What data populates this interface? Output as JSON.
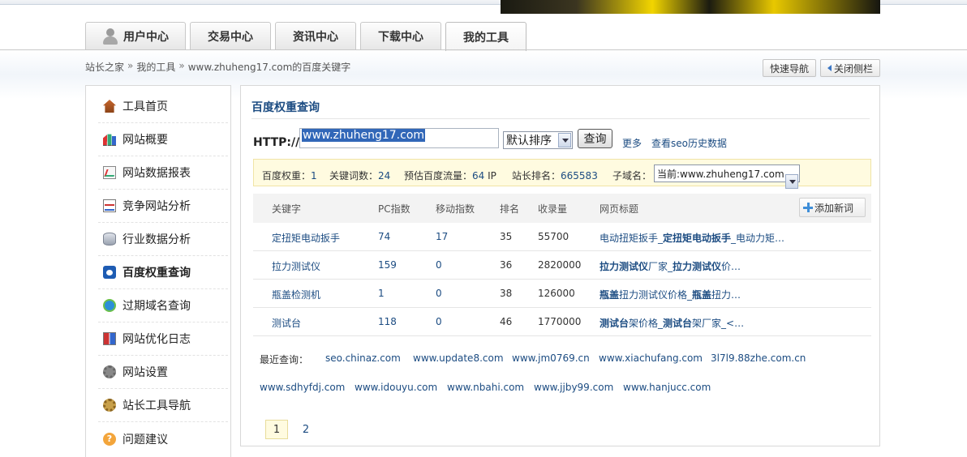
{
  "tabs": [
    {
      "label": "用户中心",
      "icon": "user-icon"
    },
    {
      "label": "交易中心"
    },
    {
      "label": "资讯中心"
    },
    {
      "label": "下载中心"
    },
    {
      "label": "我的工具",
      "active": true
    }
  ],
  "breadcrumb": {
    "home": "站长之家",
    "sep": "»",
    "section": "我的工具",
    "current": "www.zhuheng17.com的百度关键字"
  },
  "top_buttons": {
    "quick_nav": "快速导航",
    "close_side": "关闭侧栏"
  },
  "sidebar": {
    "items": [
      {
        "label": "工具首页",
        "icon": "home-icon"
      },
      {
        "label": "网站概要",
        "icon": "bar-chart-icon"
      },
      {
        "label": "网站数据报表",
        "icon": "report-icon"
      },
      {
        "label": "竞争网站分析",
        "icon": "compete-icon"
      },
      {
        "label": "行业数据分析",
        "icon": "database-icon"
      },
      {
        "label": "百度权重查询",
        "icon": "baidu-paw-icon",
        "active": true
      },
      {
        "label": "过期域名查询",
        "icon": "expire-domain-icon"
      },
      {
        "label": "网站优化日志",
        "icon": "log-book-icon"
      },
      {
        "label": "网站设置",
        "icon": "gear-icon"
      },
      {
        "label": "站长工具导航",
        "icon": "nav-compass-icon"
      },
      {
        "label": "问题建议",
        "icon": "help-icon"
      }
    ]
  },
  "main": {
    "title": "百度权重查询",
    "http_label": "HTTP://",
    "url_value": "www.zhuheng17.com",
    "sort_value": "默认排序",
    "query_label": "查询",
    "more_link": "更多",
    "history_link": "查看seo历史数据"
  },
  "stats": {
    "weight_label": "百度权重：",
    "weight": "1",
    "kw_label": "关键词数：",
    "kw": "24",
    "flow_label": "预估百度流量：",
    "flow": "64",
    "flow_unit": "IP",
    "rank_label": "站长排名：",
    "rank": "665583",
    "subdomain_label": "子域名：",
    "subdomain_value": "当前:www.zhuheng17.com"
  },
  "table": {
    "headers": {
      "kw": "关键字",
      "pc": "PC指数",
      "mobile": "移动指数",
      "rank": "排名",
      "included": "收录量",
      "title": "网页标题"
    },
    "add_label": "添加新词",
    "rows": [
      {
        "kw": "定扭矩电动扳手",
        "pc": "74",
        "mobile": "17",
        "rank": "35",
        "included": "55700",
        "t1": "电动扭矩扳手_",
        "t2": "定扭矩电动扳手",
        "t3": "_电动力矩…"
      },
      {
        "kw": "拉力测试仪",
        "pc": "159",
        "mobile": "0",
        "rank": "36",
        "included": "2820000",
        "t1": "",
        "t2": "拉力测试仪",
        "t3": "厂家_",
        "t4": "拉力测试仪",
        "t5": "价…"
      },
      {
        "kw": "瓶盖检测机",
        "pc": "1",
        "mobile": "0",
        "rank": "38",
        "included": "126000",
        "t1": "",
        "t2": "瓶盖",
        "t3": "扭力测试仪价格_",
        "t4": "瓶盖",
        "t5": "扭力…"
      },
      {
        "kw": "测试台",
        "pc": "118",
        "mobile": "0",
        "rank": "46",
        "included": "1770000",
        "t1": "",
        "t2": "测试台",
        "t3": "架价格_",
        "t4": "测试台",
        "t5": "架厂家_<…"
      }
    ]
  },
  "recent": {
    "label": "最近查询：",
    "links": [
      "seo.chinaz.com",
      "www.update8.com",
      "www.jm0769.cn",
      "www.xiachufang.com",
      "3l7l9.88zhe.com.cn",
      "www.sdhyfdj.com",
      "www.idouyu.com",
      "www.nbahi.com",
      "www.jjby99.com",
      "www.hanjucc.com"
    ]
  },
  "pager": {
    "pages": [
      "1",
      "2"
    ],
    "current": "1"
  }
}
